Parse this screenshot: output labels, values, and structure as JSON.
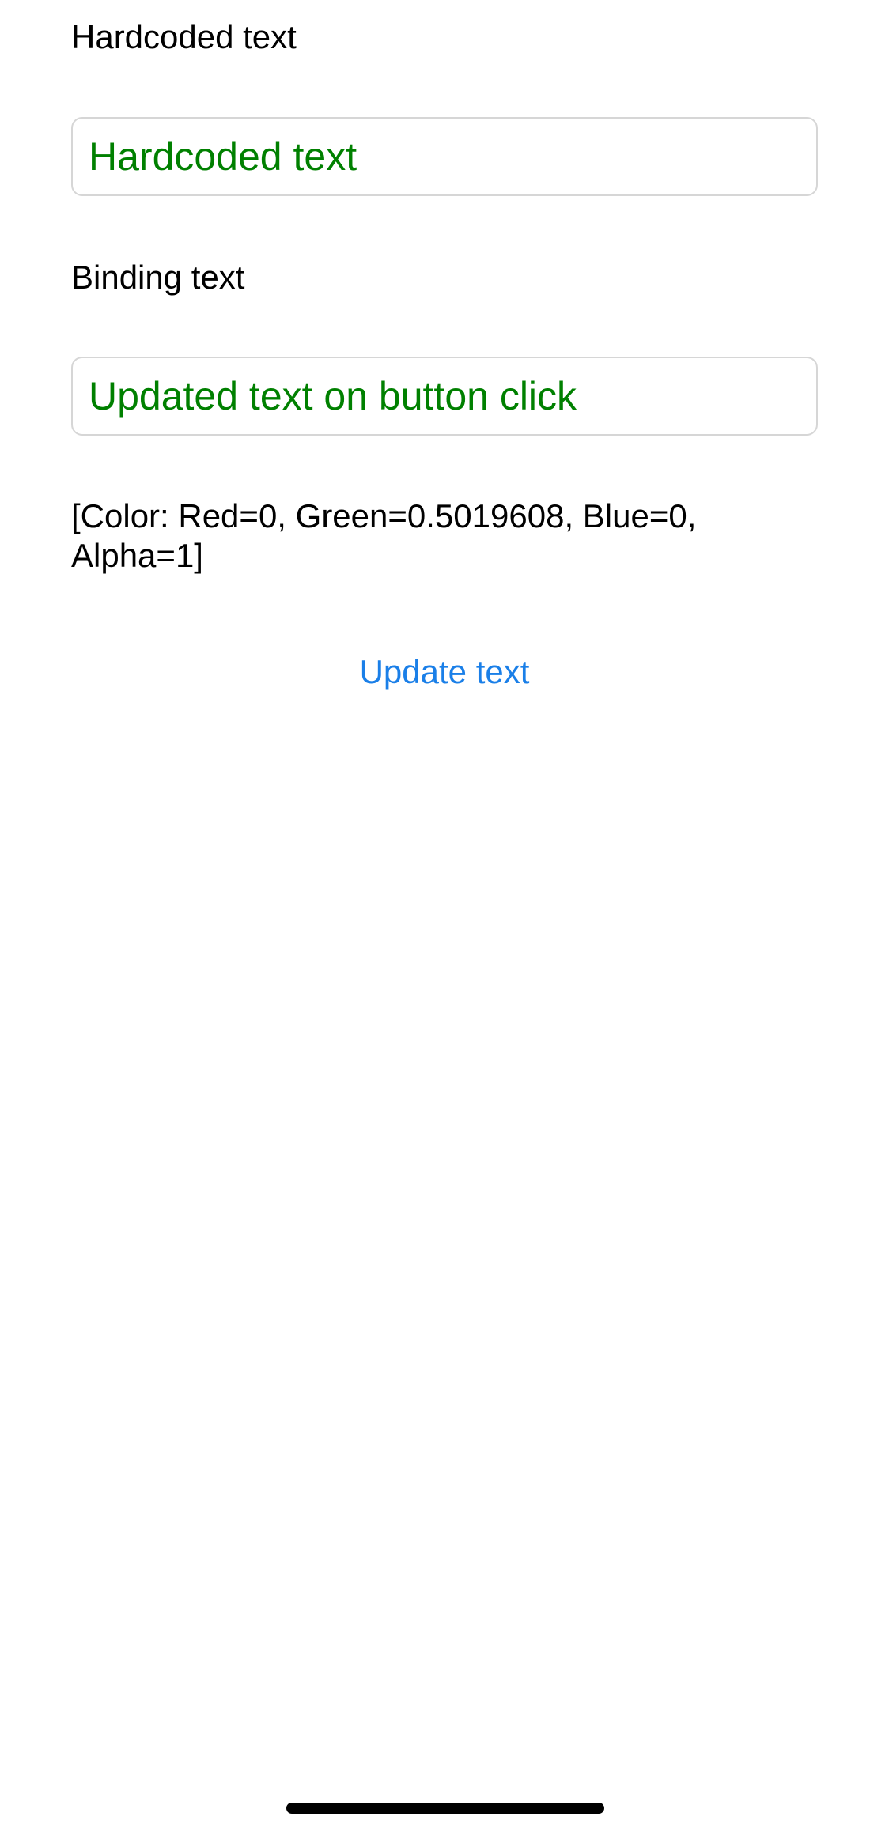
{
  "labels": {
    "hardcoded_label": "Hardcoded text",
    "binding_label": "Binding text"
  },
  "fields": {
    "hardcoded_value": "Hardcoded text",
    "binding_value": "Updated text on button click"
  },
  "color_readout": "[Color: Red=0, Green=0.5019608, Blue=0, Alpha=1]",
  "buttons": {
    "update_label": "Update text"
  },
  "colors": {
    "field_text": "#008000",
    "button_text": "#1a7fe8",
    "background": "#ffffff"
  }
}
